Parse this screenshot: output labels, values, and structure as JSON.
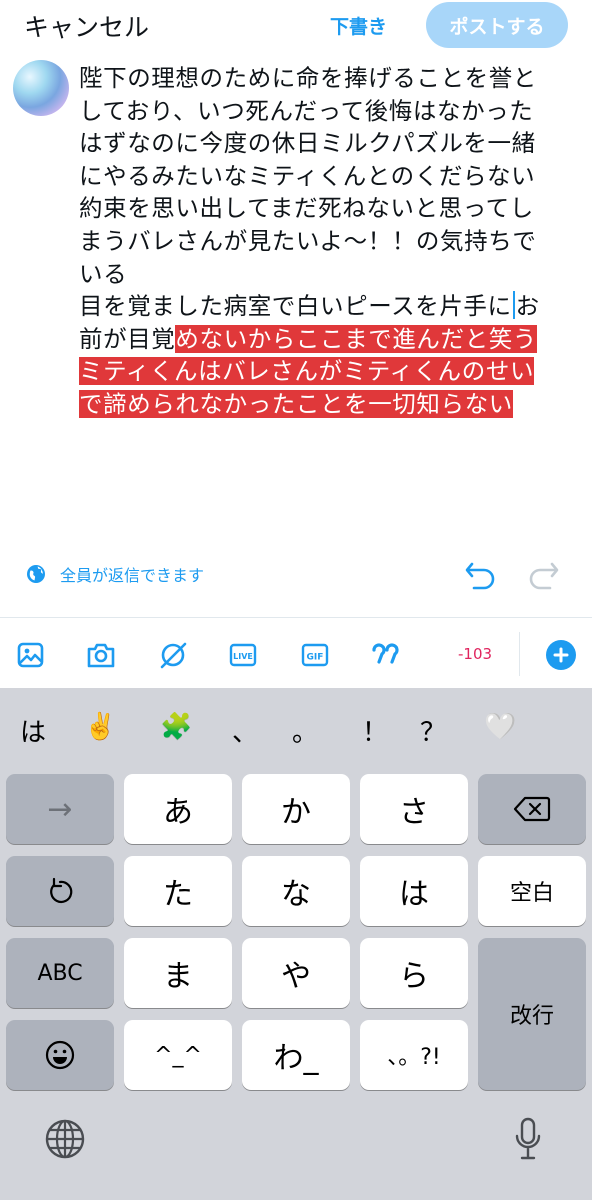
{
  "header": {
    "cancel_label": "キャンセル",
    "draft_label": "下書き",
    "post_label": "ポストする"
  },
  "compose": {
    "lines": [
      {
        "plain": "陛下の理想のために命を捧げることを誉と",
        "highlight": ""
      },
      {
        "plain": "しており、いつ死んだって後悔はなかった",
        "highlight": ""
      },
      {
        "plain": "はずなのに今度の休日ミルクパズルを一緒",
        "highlight": ""
      },
      {
        "plain": "にやるみたいなミティくんとのくだらない",
        "highlight": ""
      },
      {
        "plain": "約束を思い出してまだ死ねないと思ってし",
        "highlight": ""
      },
      {
        "plain": "まうバレさんが見たいよ〜！！の気持ちで",
        "highlight": ""
      },
      {
        "plain": "いる",
        "highlight": ""
      },
      {
        "plain": "目を覚ました病室で白いピースを片手に",
        "after_caret": "お",
        "highlight": ""
      },
      {
        "plain": "前が目覚",
        "highlight": "めないからここまで進んだと笑う"
      },
      {
        "plain": "",
        "highlight": "ミティくんはバレさんがミティくんのせい"
      },
      {
        "plain": "",
        "highlight": "で諦められなかったことを一切知らない"
      }
    ]
  },
  "reply": {
    "text": "全員が返信できます"
  },
  "toolbar": {
    "char_count": "-103",
    "icons": [
      "image-icon",
      "camera-icon",
      "grok-icon",
      "live-icon",
      "gif-icon",
      "quote-icon"
    ]
  },
  "keyboard": {
    "suggestions": [
      "は",
      "✌️",
      "🧩",
      "、",
      "。",
      "！",
      "？",
      "🤍"
    ],
    "keys": {
      "arrow": "→",
      "a": "あ",
      "ka": "か",
      "sa": "さ",
      "ta": "た",
      "na": "な",
      "ha": "は",
      "space": "空白",
      "abc": "ABC",
      "ma": "ま",
      "ya": "や",
      "ra": "ら",
      "return": "改行",
      "dakuten": "^_^",
      "wa": "わ_",
      "punct": "、。?!"
    }
  },
  "colors": {
    "accent": "#1d9bf0",
    "highlight": "#e0383a",
    "count_warning": "#e0245e"
  }
}
